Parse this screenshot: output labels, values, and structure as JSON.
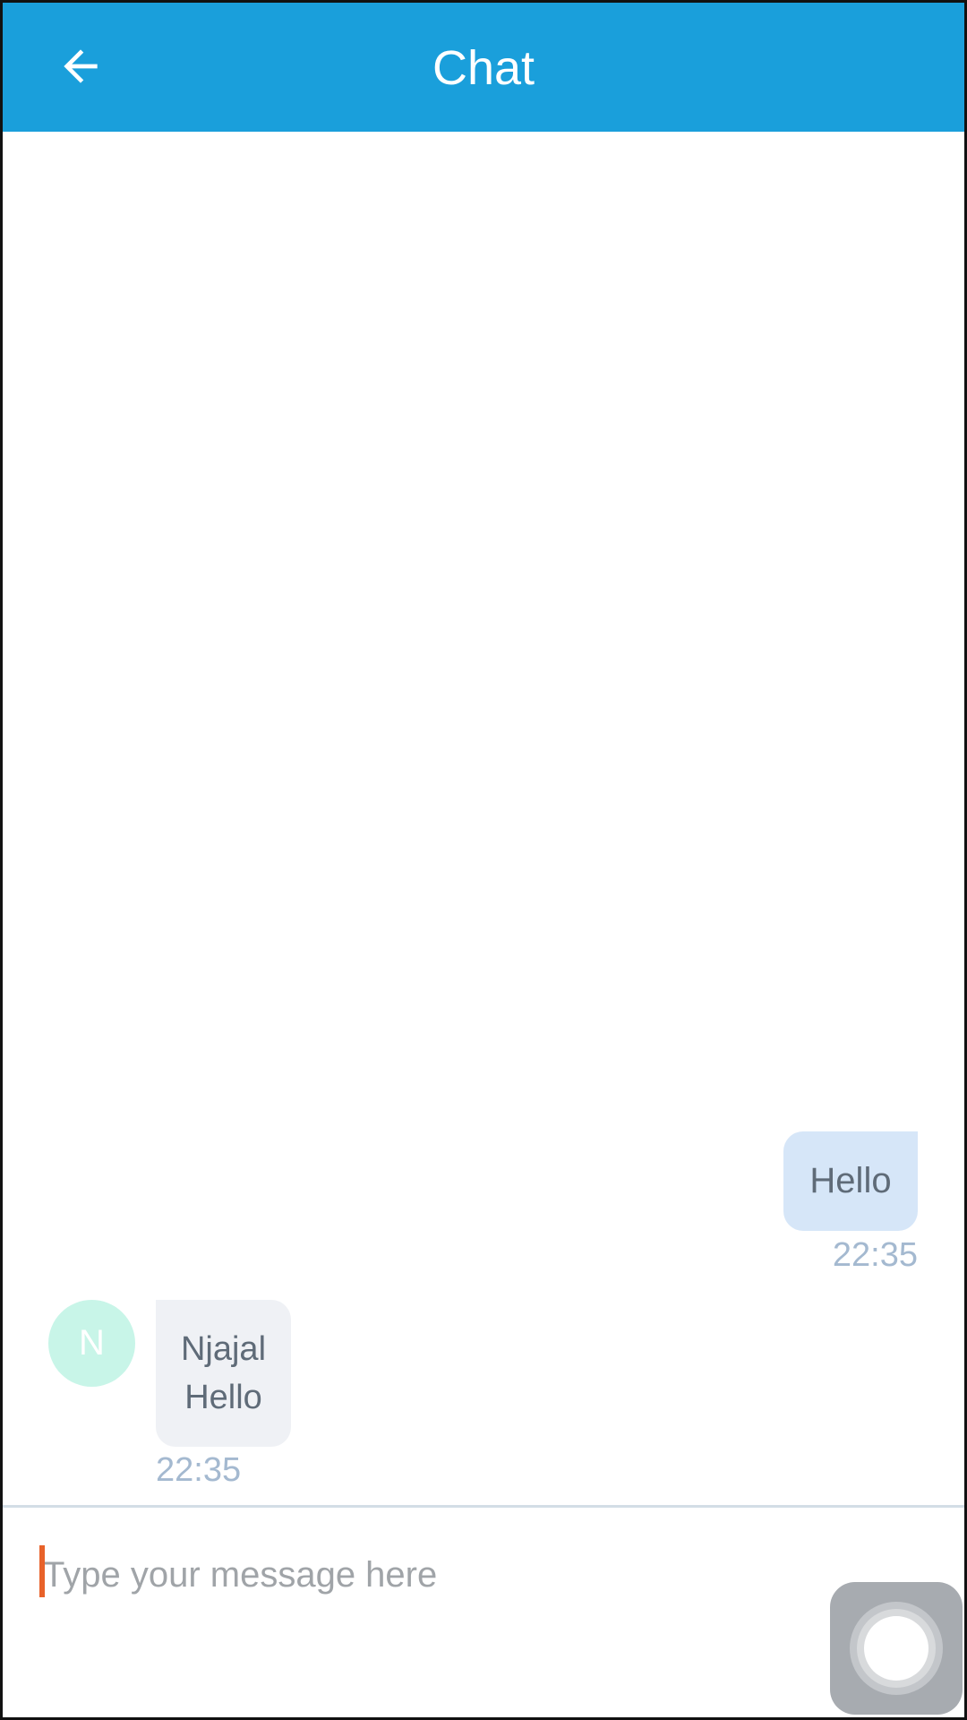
{
  "header": {
    "title": "Chat",
    "back_icon": "arrow-left-icon",
    "background_color": "#1a9fdb"
  },
  "messages": [
    {
      "direction": "outgoing",
      "text": "Hello",
      "time": "22:35"
    },
    {
      "direction": "incoming",
      "avatar_initial": "N",
      "sender": "Njajal",
      "text": "Hello",
      "time": "22:35"
    }
  ],
  "composer": {
    "placeholder": "Type your message here",
    "value": ""
  },
  "assistive_touch": {
    "icon": "assistive-touch-icon"
  }
}
